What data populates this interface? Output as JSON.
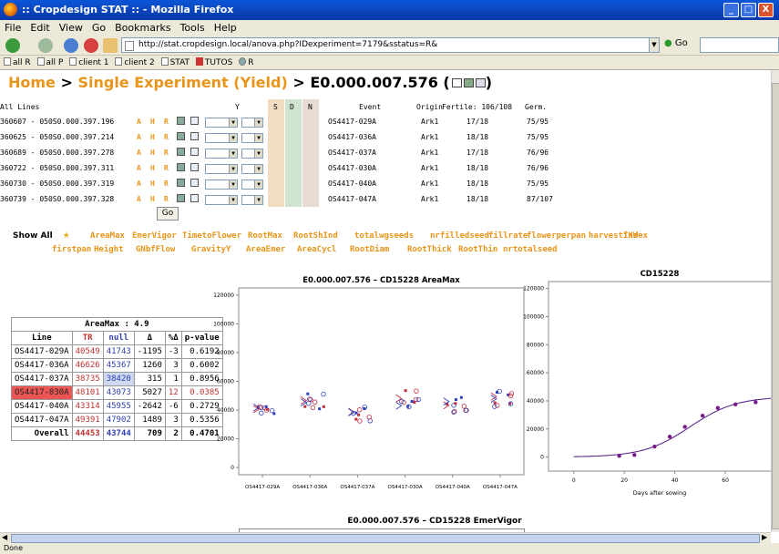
{
  "window": {
    "title": ":: Cropdesign STAT :: - Mozilla Firefox",
    "min": "_",
    "max": "□",
    "close": "X"
  },
  "menu": [
    "File",
    "Edit",
    "View",
    "Go",
    "Bookmarks",
    "Tools",
    "Help"
  ],
  "nav": {
    "url": "http://stat.cropdesign.local/anova.php?IDexperiment=7179&sstatus=R&",
    "go_label": "Go"
  },
  "bookmarks": [
    "all R",
    "all P",
    "client 1",
    "client 2",
    "STAT",
    "TUTOS",
    "R"
  ],
  "heading": {
    "home": "Home",
    "sep": ">",
    "single": "Single Experiment (Yield)",
    "sep2": ">",
    "id": "E0.000.007.576",
    "paren_open": "(",
    "paren_close": ")"
  },
  "lines_table": {
    "header": {
      "all": "All Lines",
      "y": "Y",
      "s": "S",
      "d": "D",
      "n": "N",
      "event": "Event",
      "origin": "Origin",
      "fertile": "Fertile: 106/108",
      "germ": "Germ."
    },
    "ahr": [
      "A",
      "H",
      "R"
    ],
    "rows": [
      {
        "line": "360607 - 050S0.000.397.196",
        "event": "OS4417-029A",
        "origin": "Ark1",
        "fertile": "17/18",
        "germ": "75/95"
      },
      {
        "line": "360625 - 050S0.000.397.214",
        "event": "OS4417-036A",
        "origin": "Ark1",
        "fertile": "18/18",
        "germ": "75/95"
      },
      {
        "line": "360689 - 050S0.000.397.278",
        "event": "OS4417-037A",
        "origin": "Ark1",
        "fertile": "17/18",
        "germ": "76/96"
      },
      {
        "line": "360722 - 050S0.000.397.311",
        "event": "OS4417-030A",
        "origin": "Ark1",
        "fertile": "18/18",
        "germ": "76/96"
      },
      {
        "line": "360730 - 050S0.000.397.319",
        "event": "OS4417-040A",
        "origin": "Ark1",
        "fertile": "18/18",
        "germ": "75/95"
      },
      {
        "line": "360739 - 050S0.000.397.328",
        "event": "OS4417-047A",
        "origin": "Ark1",
        "fertile": "18/18",
        "germ": "87/107"
      }
    ],
    "go": "Go"
  },
  "traits": {
    "show_all": "Show All",
    "row1": [
      "AreaMax",
      "EmerVigor",
      "TimetoFlower",
      "RootMax",
      "RootShInd",
      "totalwgseeds",
      "nrfilledseed",
      "fillrate",
      "flowerperpan",
      "harvestindex",
      "TKW"
    ],
    "row2": [
      "firstpan",
      "Height",
      "GNbfFlow",
      "GravityY",
      "AreaEmer",
      "AreaCycl",
      "RootDiam",
      "RootThick",
      "RootThin",
      "nrtotalseed"
    ]
  },
  "summary": {
    "caption": "AreaMax :   4.9",
    "headers": [
      "Line",
      "TR",
      "null",
      "Δ",
      "%Δ",
      "p-value"
    ],
    "rows": [
      {
        "line": "OS4417-029A",
        "tr": "40549",
        "null": "41743",
        "d": "-1195",
        "pd": "-3",
        "p": "0.6192"
      },
      {
        "line": "OS4417-036A",
        "tr": "46626",
        "null": "45367",
        "d": "1260",
        "pd": "3",
        "p": "0.6002"
      },
      {
        "line": "OS4417-037A",
        "tr": "38735",
        "null": "38420",
        "d": "315",
        "pd": "1",
        "p": "0.8956"
      },
      {
        "line": "OS4417-030A",
        "tr": "48101",
        "null": "43073",
        "d": "5027",
        "pd": "12",
        "p": "0.0385"
      },
      {
        "line": "OS4417-040A",
        "tr": "43314",
        "null": "45955",
        "d": "-2642",
        "pd": "-6",
        "p": "0.2729"
      },
      {
        "line": "OS4417-047A",
        "tr": "49391",
        "null": "47902",
        "d": "1489",
        "pd": "3",
        "p": "0.5356"
      }
    ],
    "overall": {
      "line": "Overall",
      "tr": "44453",
      "null": "43744",
      "d": "709",
      "pd": "2",
      "p": "0.4701"
    }
  },
  "chart_data": [
    {
      "type": "scatter",
      "title": "E0.000.007.576 – CD15228   AreaMax",
      "categories": [
        "OS4417-029A",
        "OS4417-036A",
        "OS4417-037A",
        "OS4417-030A",
        "OS4417-040A",
        "OS4417-047A"
      ],
      "ylim": [
        0,
        125000
      ],
      "yticks": [
        0,
        20000,
        40000,
        60000,
        80000,
        100000,
        120000
      ],
      "tr_means": [
        40549,
        46626,
        38735,
        48101,
        43314,
        49391
      ],
      "null_means": [
        41743,
        45367,
        38420,
        43073,
        45955,
        47902
      ],
      "spread": [
        5000,
        6500,
        7000,
        6000,
        7500,
        6500
      ],
      "colors": {
        "tr": "#c03040",
        "null": "#3040c0"
      }
    },
    {
      "type": "line",
      "title": "CD15228",
      "xlabel": "Days after sowing",
      "xlim": [
        -10,
        78
      ],
      "ylim": [
        -10000,
        125000
      ],
      "xticks": [
        0,
        20,
        40,
        60
      ],
      "yticks": [
        0,
        20000,
        40000,
        60000,
        80000,
        100000,
        120000
      ],
      "points": {
        "x": [
          18,
          24,
          32,
          38,
          44,
          51,
          57,
          64,
          72
        ],
        "y": [
          800,
          1500,
          7500,
          14500,
          21500,
          29500,
          35000,
          37500,
          39000
        ]
      },
      "curve": {
        "asymptote": 43000,
        "midpoint": 46,
        "rate": 0.11
      },
      "colors": {
        "point": "#7a1a8a",
        "curve": "#5b2a8c"
      }
    }
  ],
  "next_chart_title": "E0.000.007.576 – CD15228   EmerVigor",
  "status": "Done"
}
